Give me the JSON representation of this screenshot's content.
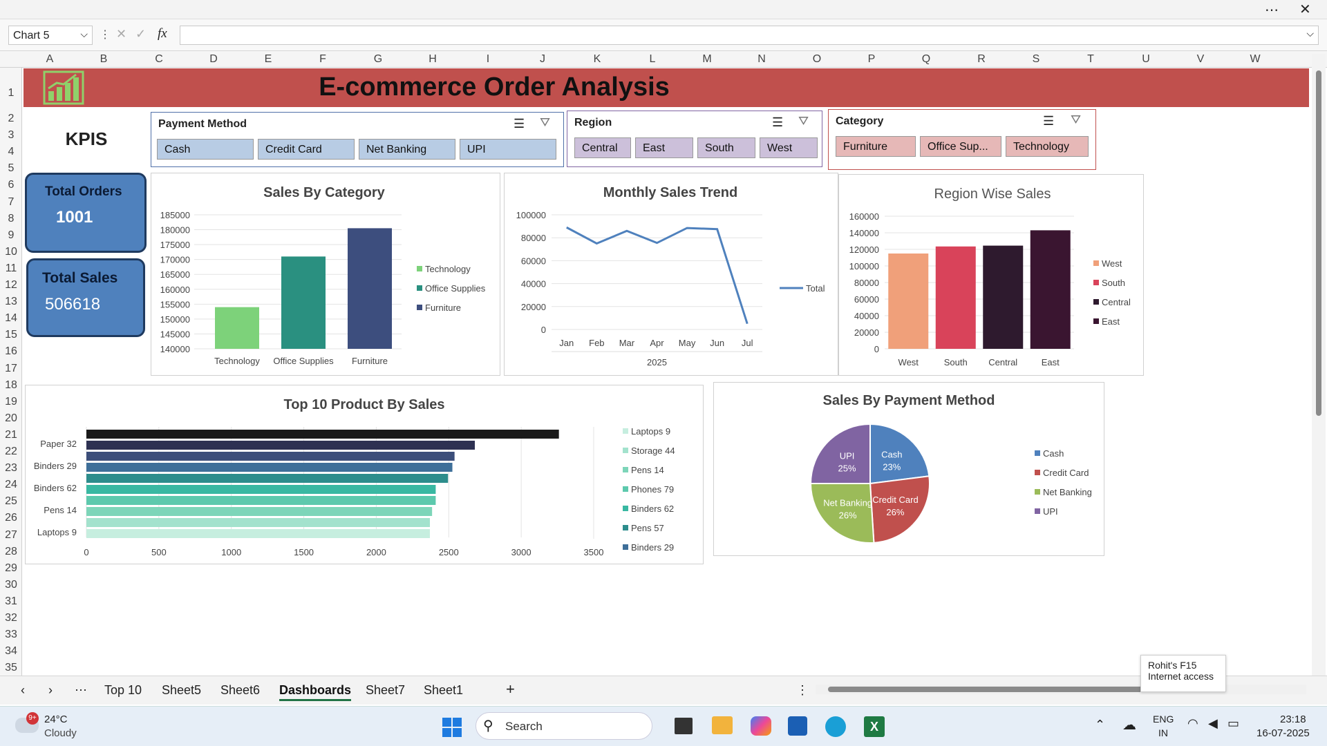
{
  "namebox": {
    "value": "Chart 5"
  },
  "formula": {
    "fx_label": "fx",
    "value": ""
  },
  "columns": [
    "A",
    "B",
    "C",
    "D",
    "E",
    "F",
    "G",
    "H",
    "I",
    "J",
    "K",
    "L",
    "M",
    "N",
    "O",
    "P",
    "Q",
    "R",
    "S",
    "T",
    "U",
    "V",
    "W"
  ],
  "rows": [
    "1",
    "2",
    "3",
    "4",
    "5",
    "6",
    "7",
    "8",
    "9",
    "10",
    "11",
    "12",
    "13",
    "14",
    "15",
    "16",
    "17",
    "18",
    "19",
    "20",
    "21",
    "22",
    "23",
    "24",
    "25",
    "26",
    "27",
    "28",
    "29",
    "30",
    "31",
    "32",
    "33",
    "34",
    "35"
  ],
  "banner": {
    "title": "E-commerce Order Analysis"
  },
  "kpis": {
    "heading": "KPIS",
    "total_orders_label": "Total Orders",
    "total_orders_value": "1001",
    "total_sales_label": "Total Sales",
    "total_sales_value": "506618"
  },
  "slicers": {
    "payment": {
      "title": "Payment Method",
      "items": [
        "Cash",
        "Credit Card",
        "Net Banking",
        "UPI"
      ]
    },
    "region": {
      "title": "Region",
      "items": [
        "Central",
        "East",
        "South",
        "West"
      ]
    },
    "category": {
      "title": "Category",
      "items": [
        "Furniture",
        "Office Sup...",
        "Technology"
      ]
    }
  },
  "colors": {
    "banner": "#c0504d",
    "kpi": "#4f81bd",
    "slicer_payment": "#b8cce4",
    "slicer_region": "#ccc0da",
    "slicer_category": "#e6b8b7"
  },
  "chart_data": [
    {
      "type": "bar",
      "title": "Sales By Category",
      "categories": [
        "Technology",
        "Office Supplies",
        "Furniture"
      ],
      "values": [
        154000,
        171000,
        180500
      ],
      "colors": [
        "#7dd27a",
        "#2a9080",
        "#3d4e7e"
      ],
      "ylim": [
        140000,
        185000
      ],
      "yticks": [
        "140000",
        "145000",
        "150000",
        "155000",
        "160000",
        "165000",
        "170000",
        "175000",
        "180000",
        "185000"
      ],
      "legend": [
        "Technology",
        "Office Supplies",
        "Furniture"
      ]
    },
    {
      "type": "line",
      "title": "Monthly Sales Trend",
      "categories": [
        "Jan",
        "Feb",
        "Mar",
        "Apr",
        "May",
        "Jun",
        "Jul"
      ],
      "xlabel": "2025",
      "series": [
        {
          "name": "Total",
          "values": [
            89000,
            75000,
            86000,
            75500,
            88500,
            87500,
            5000
          ]
        }
      ],
      "ylim": [
        0,
        100000
      ],
      "yticks": [
        "0",
        "20000",
        "40000",
        "60000",
        "80000",
        "100000"
      ],
      "color": "#4f81bd"
    },
    {
      "type": "bar",
      "title": "Region Wise Sales",
      "categories": [
        "West",
        "South",
        "Central",
        "East"
      ],
      "values": [
        115000,
        123500,
        124500,
        143000
      ],
      "colors": [
        "#f0a07a",
        "#d9435a",
        "#2e1a2e",
        "#3a1530"
      ],
      "ylim": [
        0,
        160000
      ],
      "yticks": [
        "0",
        "20000",
        "40000",
        "60000",
        "80000",
        "100000",
        "120000",
        "140000",
        "160000"
      ],
      "legend": [
        "West",
        "South",
        "Central",
        "East"
      ]
    },
    {
      "type": "bar",
      "title": "Top 10 Product By Sales",
      "orientation": "horizontal",
      "categories": [
        "Paper 32",
        "Binders 29",
        "Binders 62",
        "Pens 14",
        "Laptops 9"
      ],
      "bars": [
        3260,
        2680,
        2540,
        2525,
        2495,
        2410,
        2410,
        2385,
        2370,
        2370
      ],
      "bar_colors": [
        "#1a1a1a",
        "#2e3152",
        "#3c4e7a",
        "#3e6f99",
        "#2d8d8c",
        "#39b8a2",
        "#5dc9ad",
        "#7dd5b9",
        "#a3e2cd",
        "#c6eedf"
      ],
      "xlim": [
        0,
        3500
      ],
      "xticks": [
        "0",
        "500",
        "1000",
        "1500",
        "2000",
        "2500",
        "3000",
        "3500"
      ],
      "legend": [
        {
          "name": "Laptops 9",
          "color": "#c6eedf"
        },
        {
          "name": "Storage 44",
          "color": "#a3e2cd"
        },
        {
          "name": "Pens 14",
          "color": "#7dd5b9"
        },
        {
          "name": "Phones 79",
          "color": "#5dc9ad"
        },
        {
          "name": "Binders 62",
          "color": "#39b8a2"
        },
        {
          "name": "Pens 57",
          "color": "#2d8d8c"
        },
        {
          "name": "Binders 29",
          "color": "#3e6f99"
        }
      ]
    },
    {
      "type": "pie",
      "title": "Sales By Payment Method",
      "slices": [
        {
          "label": "Cash",
          "pct": 23,
          "color": "#4f81bd"
        },
        {
          "label": "Credit Card",
          "pct": 26,
          "color": "#c0504d"
        },
        {
          "label": "Net Banking",
          "pct": 26,
          "color": "#9bbb59"
        },
        {
          "label": "UPI",
          "pct": 25,
          "color": "#8064a2"
        }
      ],
      "slice_labels": [
        "Cash\n23%",
        "Credit Card\n26%",
        "Net Banking\n26%",
        "UPI\n25%"
      ],
      "legend": [
        "Cash",
        "Credit Card",
        "Net Banking",
        "UPI"
      ]
    }
  ],
  "tabs": [
    "Top 10",
    "Sheet5",
    "Sheet6",
    "Dashboards",
    "Sheet7",
    "Sheet1"
  ],
  "active_tab": "Dashboards",
  "tooltip": {
    "line1": "Rohit's F15",
    "line2": "Internet access"
  },
  "taskbar": {
    "weather_temp": "24°C",
    "weather_desc": "Cloudy",
    "weather_badge": "9+",
    "search": "Search",
    "lang1": "ENG",
    "lang2": "IN",
    "time": "23:18",
    "date": "16-07-2025"
  }
}
